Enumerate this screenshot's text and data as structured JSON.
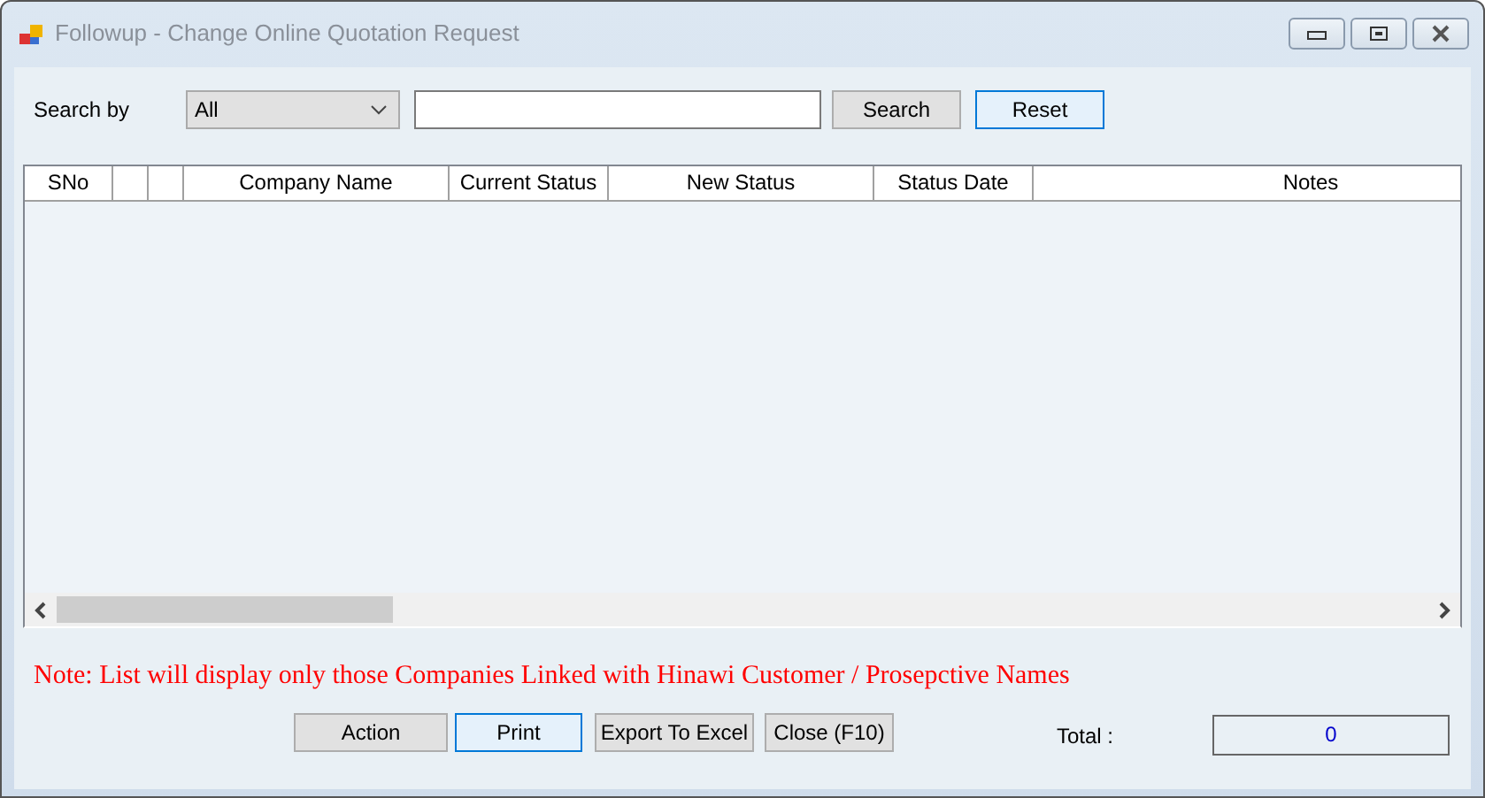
{
  "window": {
    "title": "Followup - Change Online Quotation Request"
  },
  "search": {
    "label": "Search by",
    "dropdown": {
      "value": "All"
    },
    "buttons": [
      {
        "label": "Search",
        "focused": false
      },
      {
        "label": "Reset",
        "focused": true
      }
    ]
  },
  "table": {
    "columns": [
      {
        "kind": "text",
        "label": "SNo"
      },
      {
        "kind": "blank"
      },
      {
        "kind": "blank"
      },
      {
        "kind": "text",
        "label": "Company Name"
      },
      {
        "kind": "text",
        "label": "Current Status"
      },
      {
        "kind": "text",
        "label": "New Status"
      },
      {
        "kind": "text",
        "label": "Status Date"
      },
      {
        "kind": "text",
        "label": "Notes"
      }
    ]
  },
  "note": "Note: List will display only those Companies Linked with Hinawi Customer / Prosepctive Names",
  "buttons": [
    {
      "label": "Action",
      "focused": false
    },
    {
      "label": "Print",
      "focused": true
    },
    {
      "label": "Export To Excel",
      "focused": false
    },
    {
      "label": "Close (F10)",
      "focused": false
    }
  ],
  "total": {
    "label": "Total :",
    "value": "0"
  }
}
